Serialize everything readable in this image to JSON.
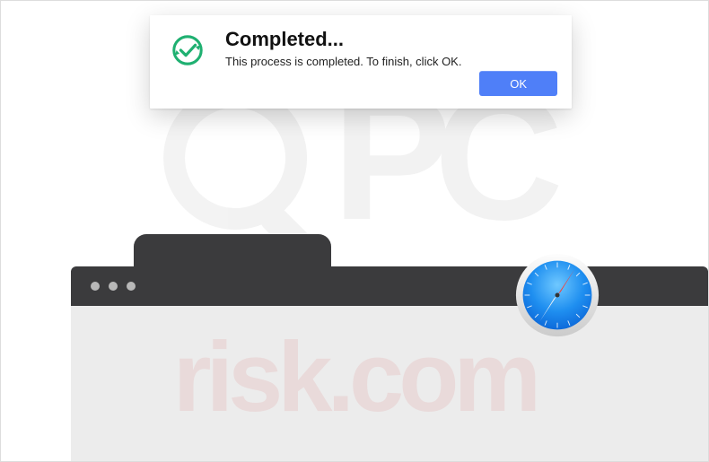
{
  "dialog": {
    "title": "Completed...",
    "message": "This process is completed. To finish, click OK.",
    "ok_label": "OK"
  },
  "watermark": {
    "top": "PC",
    "bottom": "risk.com"
  }
}
